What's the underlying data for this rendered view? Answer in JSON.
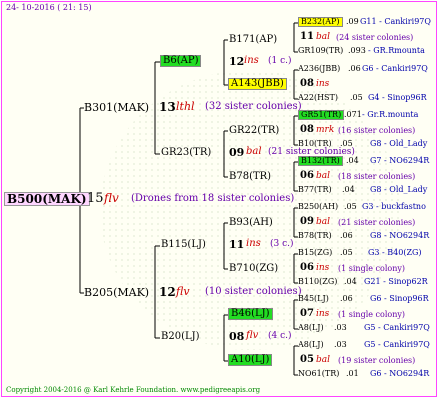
{
  "header": {
    "date": "24- 10-2016 ( 21: 15)"
  },
  "footer": {
    "copyright": "Copyright 2004-2016 @ Karl Kehrle Foundation.   www.pedigreeapis.org"
  },
  "colors": {
    "frame": "#ff44ff",
    "highlight_yellow": "#ffff00",
    "highlight_green": "#22dd22",
    "red_text": "#cc0000",
    "sub_text": "#6600aa",
    "location_text": "#0000aa"
  },
  "gen0": {
    "name": "B500(MAK)",
    "num": "15",
    "abbr": "flv",
    "note": "(Drones from 18 sister colonies)"
  },
  "gen1": [
    {
      "name": "B301(MAK)",
      "num": "13",
      "abbr": "lthl",
      "note": "(32 sister colonies)"
    },
    {
      "name": "B205(MAK)",
      "num": "12",
      "abbr": "flv",
      "note": "(10 sister colonies)"
    }
  ],
  "gen2": [
    {
      "name": "B6(AP)",
      "num": "",
      "abbr": "",
      "note": ""
    },
    {
      "name": "GR23(TR)",
      "num": "09",
      "abbr": "bal",
      "note": "(21 sister colonies)"
    },
    {
      "name": "B115(LJ)",
      "num": "11",
      "abbr": "ins",
      "note": "(3 c.)"
    },
    {
      "name": "B20(LJ)",
      "num": "08",
      "abbr": "flv",
      "note": "(4 c.)"
    }
  ],
  "gen3": [
    {
      "name": "B171(AP)",
      "num": "12",
      "abbr": "ins",
      "note": "(1 c.)"
    },
    {
      "name": "A143(JBB)",
      "num": "08",
      "abbr": "ins",
      "note": ""
    },
    {
      "name": "GR22(TR)",
      "num": "08",
      "abbr": "mrk",
      "note": "(16 sister colonies)"
    },
    {
      "name": "B78(TR)",
      "num": "06",
      "abbr": "bal",
      "note": "(18 sister colonies)"
    },
    {
      "name": "B93(AH)",
      "num": "09",
      "abbr": "bal",
      "note": "(21 sister colonies)"
    },
    {
      "name": "B710(ZG)",
      "num": "06",
      "abbr": "ins",
      "note": "(1 single colony)"
    },
    {
      "name": "B46(LJ)",
      "num": "07",
      "abbr": "ins",
      "note": "(1 single colony)"
    },
    {
      "name": "A10(LJ)",
      "num": "05",
      "abbr": "bal",
      "note": "(19 sister colonies)"
    }
  ],
  "gen4": [
    {
      "name": "B232(AP)",
      "year": ".09",
      "loc": "G11 - Cankiri97Q"
    },
    {
      "name": "GR109(TR)",
      "year": ".093",
      "loc": "- GR.Rmounta"
    },
    {
      "name": "A236(JBB)",
      "year": ".06",
      "loc": "G6 - Cankiri97Q"
    },
    {
      "name": "A22(HST)",
      "year": ".05",
      "loc": "G4 - Sinop96R"
    },
    {
      "name": "GR51(TR)",
      "year": ".071",
      "loc": "- Gr.R.mounta"
    },
    {
      "name": "B10(TR)",
      "year": ".05",
      "loc": "G8 - Old_Lady"
    },
    {
      "name": "B132(TR)",
      "year": ".04",
      "loc": "G7 - NO6294R"
    },
    {
      "name": "B77(TR)",
      "year": ".04",
      "loc": "G8 - Old_Lady"
    },
    {
      "name": "B250(AH)",
      "year": ".05",
      "loc": "G3 - buckfastno"
    },
    {
      "name": "B78(TR)",
      "year": ".06",
      "loc": "G8 - NO6294R"
    },
    {
      "name": "B15(ZG)",
      "year": ".05",
      "loc": "G3 - B40(ZG)"
    },
    {
      "name": "B110(ZG)",
      "year": ".04",
      "loc": "G21 - Sinop62R"
    },
    {
      "name": "B45(LJ)",
      "year": ".06",
      "loc": "G6 - Sinop96R"
    },
    {
      "name": "A8(LJ)",
      "year": ".03",
      "loc": "G5 - Cankiri97Q"
    },
    {
      "name": "A8(LJ)",
      "year": ".03",
      "loc": "G5 - Cankiri97Q"
    },
    {
      "name": "NO61(TR)",
      "year": ".01",
      "loc": "G6 - NO6294R"
    }
  ],
  "gen4_mid": [
    {
      "num": "11",
      "abbr": "bal",
      "note": "(24 sister colonies)"
    },
    {
      "num": "08",
      "abbr": "ins",
      "note": ""
    },
    {
      "num": "08",
      "abbr": "mrk",
      "note": "(16 sister colonies)"
    },
    {
      "num": "06",
      "abbr": "bal",
      "note": "(18 sister colonies)"
    },
    {
      "num": "09",
      "abbr": "bal",
      "note": "(21 sister colonies)"
    },
    {
      "num": "06",
      "abbr": "ins",
      "note": "(1 single colony)"
    },
    {
      "num": "07",
      "abbr": "ins",
      "note": "(1 single colony)"
    },
    {
      "num": "05",
      "abbr": "bal",
      "note": "(19 sister colonies)"
    }
  ]
}
